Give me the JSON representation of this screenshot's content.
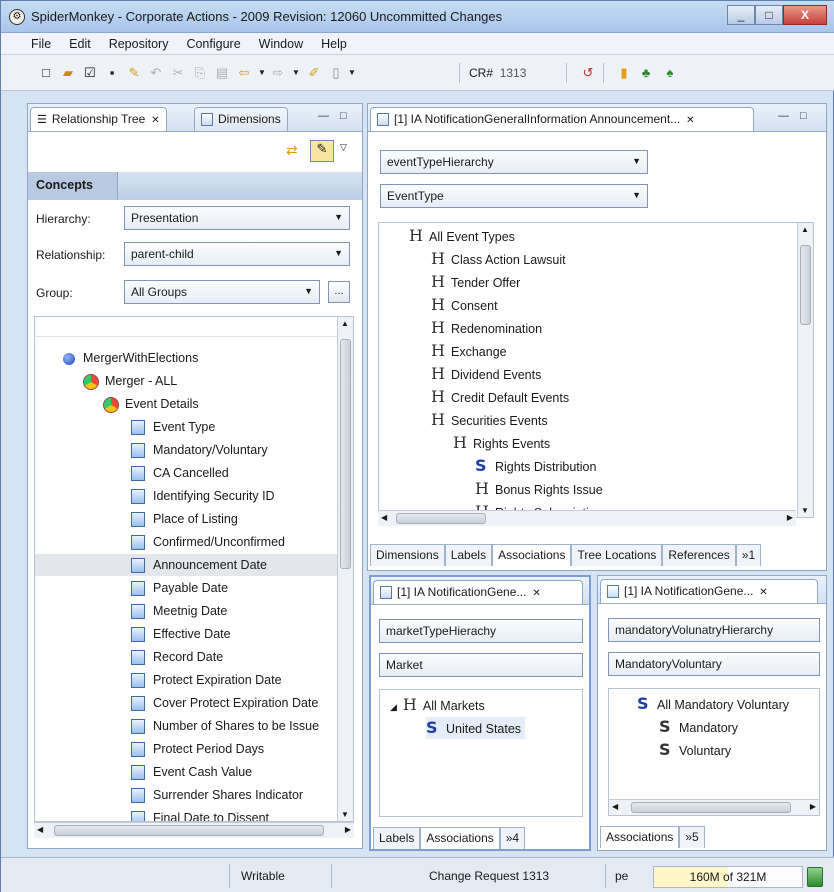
{
  "window": {
    "title": "SpiderMonkey - Corporate Actions - 2009 Revision: 12060 Uncommitted Changes",
    "controls": [
      "_",
      "□",
      "X"
    ]
  },
  "menu": [
    "File",
    "Edit",
    "Repository",
    "Configure",
    "Window",
    "Help"
  ],
  "toolbar": {
    "cr_label": "CR#",
    "cr_value": "1313"
  },
  "left_panel": {
    "tabs": [
      "Relationship Tree",
      "Dimensions"
    ],
    "section": "Concepts",
    "fields": [
      {
        "label": "Hierarchy:",
        "value": "Presentation"
      },
      {
        "label": "Relationship:",
        "value": "parent-child"
      },
      {
        "label": "Group:",
        "value": "All Groups"
      }
    ],
    "ellipsis": "...",
    "tree": [
      {
        "label": "MergerWithElections"
      },
      {
        "label": "Merger - ALL"
      },
      {
        "label": "Event Details"
      },
      {
        "label": "Event Type"
      },
      {
        "label": "Mandatory/Voluntary"
      },
      {
        "label": "CA Cancelled"
      },
      {
        "label": "Identifying Security ID"
      },
      {
        "label": "Place of Listing"
      },
      {
        "label": "Confirmed/Unconfirmed"
      },
      {
        "label": "Announcement Date"
      },
      {
        "label": "Payable Date"
      },
      {
        "label": "Meetnig Date"
      },
      {
        "label": "Effective Date"
      },
      {
        "label": "Record Date"
      },
      {
        "label": "Protect Expiration Date"
      },
      {
        "label": "Cover Protect Expiration Date"
      },
      {
        "label": "Number of Shares to be Issue"
      },
      {
        "label": "Protect Period Days"
      },
      {
        "label": "Event Cash Value"
      },
      {
        "label": "Surrender Shares Indicator"
      },
      {
        "label": "Final Date to Dissent"
      }
    ]
  },
  "right_top": {
    "tab": "[1] IA NotificationGeneralInformation Announcement...",
    "combo1": "eventTypeHierarchy",
    "combo2": "EventType",
    "tree": [
      {
        "icon": "H",
        "label": "All Event Types"
      },
      {
        "icon": "H",
        "label": "Class Action Lawsuit"
      },
      {
        "icon": "H",
        "label": "Tender Offer"
      },
      {
        "icon": "H",
        "label": "Consent"
      },
      {
        "icon": "H",
        "label": "Redenomination"
      },
      {
        "icon": "H",
        "label": "Exchange"
      },
      {
        "icon": "H",
        "label": "Dividend Events"
      },
      {
        "icon": "H",
        "label": "Credit Default Events"
      },
      {
        "icon": "H",
        "label": "Securities Events"
      },
      {
        "icon": "H",
        "label": "Rights Events"
      },
      {
        "icon": "S",
        "label": "Rights Distribution"
      },
      {
        "icon": "H",
        "label": "Bonus Rights Issue"
      },
      {
        "icon": "H",
        "label": "Rights Subscription"
      }
    ],
    "bottom_tabs": [
      "Dimensions",
      "Labels",
      "Associations",
      "Tree Locations",
      "References",
      "»1"
    ]
  },
  "bottom_left": {
    "tab": "[1] IA NotificationGene...",
    "combo1": "marketTypeHierachy",
    "combo2": "Market",
    "tree": [
      {
        "icon": "H",
        "label": "All Markets"
      },
      {
        "icon": "S",
        "label": "United States"
      }
    ],
    "bottom_tabs": [
      "Labels",
      "Associations",
      "»4"
    ]
  },
  "bottom_right": {
    "tab": "[1] IA NotificationGene...",
    "combo1": "mandatoryVolunatryHierarchy",
    "combo2": "MandatoryVoluntary",
    "tree": [
      {
        "icon": "S",
        "label": "All Mandatory Voluntary"
      },
      {
        "icon": "S",
        "label": "Mandatory"
      },
      {
        "icon": "S",
        "label": "Voluntary"
      }
    ],
    "bottom_tabs": [
      "Associations",
      "»5"
    ]
  },
  "status": {
    "writable": "Writable",
    "change_request": "Change Request 1313",
    "user": "pe",
    "heap": "160M of 321M",
    "heap_used_fraction": 0.5
  }
}
